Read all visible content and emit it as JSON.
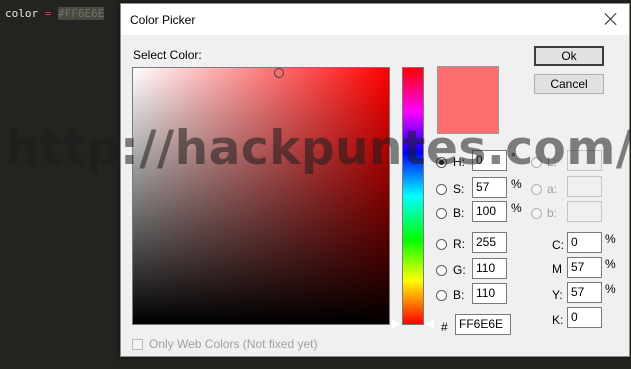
{
  "editor": {
    "code_var": "color",
    "code_op": "=",
    "code_value": "#FF6E6E"
  },
  "dialog": {
    "title": "Color Picker",
    "select_label": "Select Color:",
    "ok_label": "Ok",
    "cancel_label": "Cancel",
    "preview_color": "#ff6e6e",
    "hsb": {
      "h_label": "H:",
      "h_value": "0",
      "h_unit": "°",
      "s_label": "S:",
      "s_value": "57",
      "s_unit": "%",
      "b_label": "B:",
      "b_value": "100",
      "b_unit": "%"
    },
    "lab": {
      "l_label": "L:",
      "l_value": "",
      "a_label": "a:",
      "a_value": "",
      "b_label": "b:",
      "b_value": ""
    },
    "rgb": {
      "r_label": "R:",
      "r_value": "255",
      "g_label": "G:",
      "g_value": "110",
      "b_label": "B:",
      "b_value": "110"
    },
    "cmyk": {
      "c_label": "C:",
      "c_value": "0",
      "c_unit": "%",
      "m_label": "M",
      "m_value": "57",
      "m_unit": "%",
      "y_label": "Y:",
      "y_value": "57",
      "y_unit": "%",
      "k_label": "K:",
      "k_value": "0"
    },
    "hex_label": "#",
    "hex_value": "FF6E6E",
    "web_colors_label": "Only Web Colors (Not fixed yet)"
  },
  "watermark": "http://hackpuntes.com/"
}
